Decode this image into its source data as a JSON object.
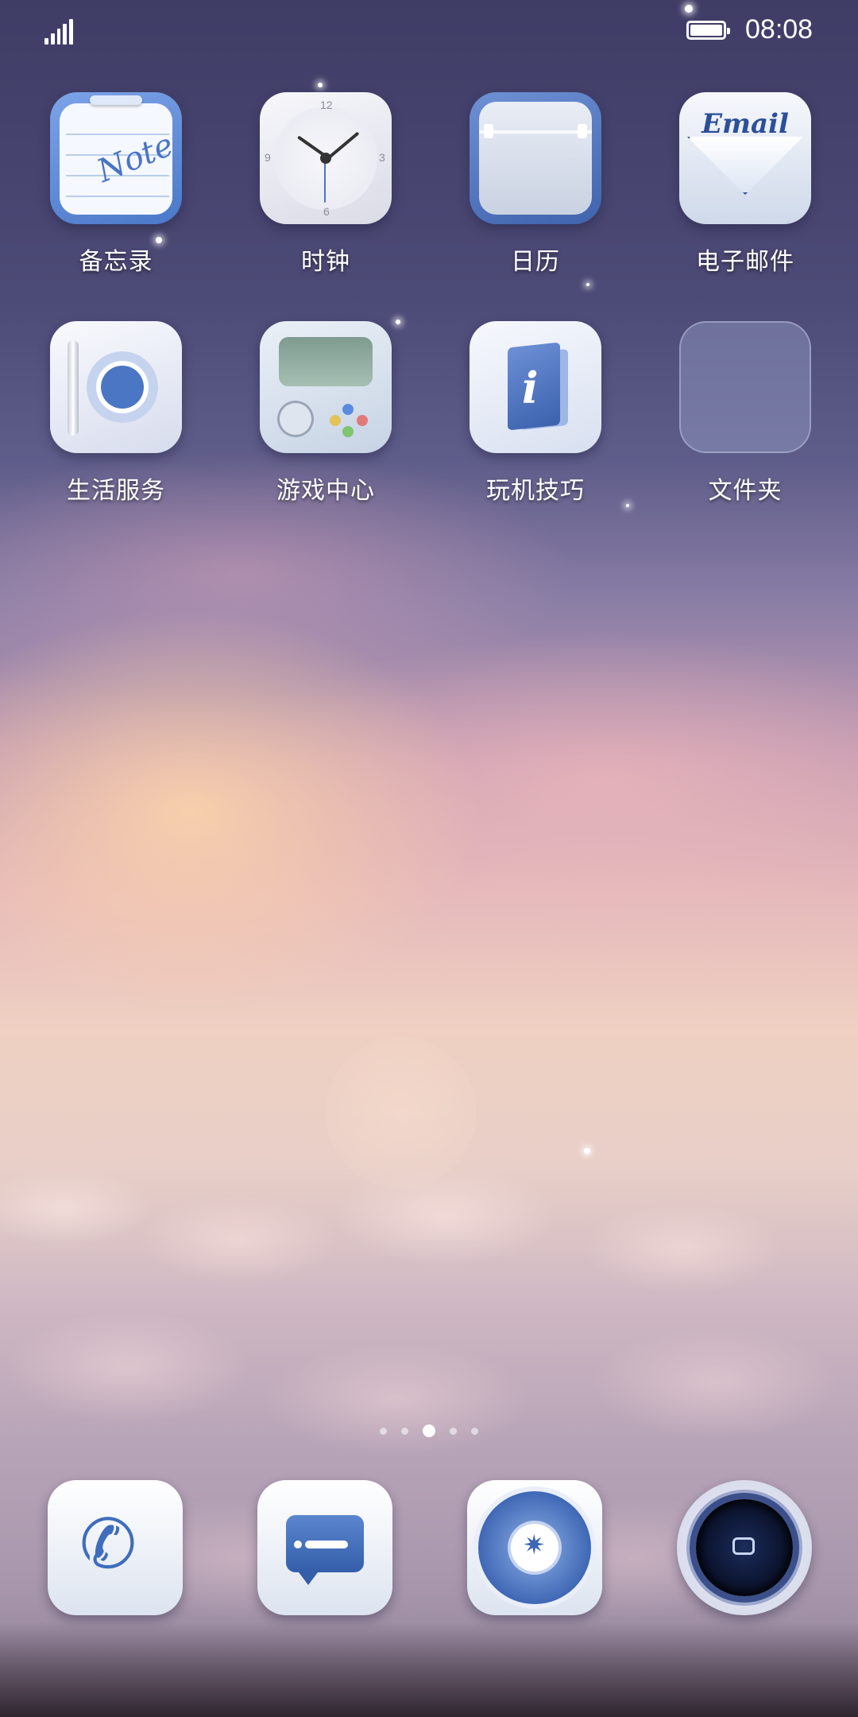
{
  "status_bar": {
    "time": "08:08",
    "signal_icon": "signal-strength-icon",
    "battery_icon": "battery-full-icon"
  },
  "home_screen": {
    "apps": [
      {
        "label": "备忘录",
        "icon": "note-icon",
        "icon_text": "Note"
      },
      {
        "label": "时钟",
        "icon": "clock-icon"
      },
      {
        "label": "日历",
        "icon": "calendar-icon"
      },
      {
        "label": "电子邮件",
        "icon": "email-icon",
        "icon_text": "Email"
      },
      {
        "label": "生活服务",
        "icon": "life-services-icon"
      },
      {
        "label": "游戏中心",
        "icon": "game-center-icon"
      },
      {
        "label": "玩机技巧",
        "icon": "tips-icon",
        "icon_text": "i"
      },
      {
        "label": "文件夹",
        "icon": "folder-icon"
      }
    ],
    "page_indicator": {
      "pages": 5,
      "current": 3
    }
  },
  "dock": [
    {
      "icon": "phone-icon"
    },
    {
      "icon": "messages-icon"
    },
    {
      "icon": "browser-compass-icon"
    },
    {
      "icon": "camera-icon"
    }
  ],
  "colors": {
    "accent_blue": "#3f6dbd",
    "label_text": "#ffffff"
  }
}
